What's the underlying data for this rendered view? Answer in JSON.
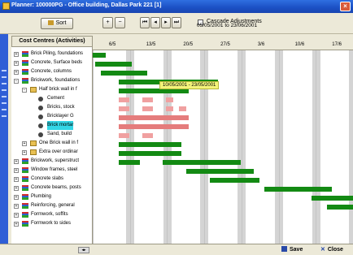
{
  "window": {
    "title": "Planner: 100000PG - Office building, Dallas Park 221 [1]",
    "close_glyph": "×"
  },
  "toolbar": {
    "sort_label": "Sort",
    "zoom_in_glyph": "+",
    "zoom_out_glyph": "−",
    "nav_first_glyph": "⏮",
    "nav_prev_glyph": "◂",
    "nav_next_glyph": "▸",
    "nav_last_glyph": "⏭",
    "cascade_label": "Cascade Adjustments",
    "cascade_checked": false,
    "date_range": "05/05/2001 to 23/06/2001"
  },
  "tree": {
    "header": "Cost Centres (Activities)",
    "rows": [
      {
        "label": "Brick Piling, foundations",
        "level": 0,
        "icon": "bars-icon",
        "expander": "+"
      },
      {
        "label": "Concrete, Surface beds",
        "level": 0,
        "icon": "bars-icon",
        "expander": "+"
      },
      {
        "label": "Concrete, columns",
        "level": 0,
        "icon": "bars-icon",
        "expander": "+"
      },
      {
        "label": "Brickwork, foundations",
        "level": 0,
        "icon": "bars-icon",
        "expander": "−"
      },
      {
        "label": "Half brick wall in f",
        "level": 1,
        "icon": "folder-icon",
        "expander": "−"
      },
      {
        "label": "Cement",
        "level": 2,
        "icon": "item-icon",
        "expander": ""
      },
      {
        "label": "Bricks, stock",
        "level": 2,
        "icon": "item-icon",
        "expander": ""
      },
      {
        "label": "Bricklayer G",
        "level": 2,
        "icon": "item-icon",
        "expander": ""
      },
      {
        "label": "Brick mortar",
        "level": 2,
        "icon": "item-icon",
        "expander": "",
        "highlight": true
      },
      {
        "label": "Sand, build",
        "level": 2,
        "icon": "item-icon",
        "expander": ""
      },
      {
        "label": "One Brick wall in f",
        "level": 1,
        "icon": "folder-icon",
        "expander": "+"
      },
      {
        "label": "Extra over ordinar",
        "level": 1,
        "icon": "folder-icon",
        "expander": "+"
      },
      {
        "label": "Brickwork, superstruct",
        "level": 0,
        "icon": "bars-icon",
        "expander": "+"
      },
      {
        "label": "Window frames, steel",
        "level": 0,
        "icon": "bars-icon",
        "expander": "+"
      },
      {
        "label": "Concrete slabs",
        "level": 0,
        "icon": "bars-icon",
        "expander": "+"
      },
      {
        "label": "Concrete beams, posts",
        "level": 0,
        "icon": "bars-icon",
        "expander": "+"
      },
      {
        "label": "Plumbing",
        "level": 0,
        "icon": "bars-icon",
        "expander": "+"
      },
      {
        "label": "Reinforcing, general",
        "level": 0,
        "icon": "bars-icon",
        "expander": "+"
      },
      {
        "label": "Formwork, soffits",
        "level": 0,
        "icon": "bars-icon",
        "expander": "+"
      },
      {
        "label": "Formwork to sides",
        "level": 0,
        "icon": "bars-icon",
        "expander": "+"
      }
    ]
  },
  "timeline": {
    "dates": [
      "6/5",
      "13/5",
      "20/5",
      "27/5",
      "3/6",
      "10/6",
      "17/6"
    ]
  },
  "gantt": {
    "tooltip": "10/05/2001 - 23/05/2001",
    "bars": [
      {
        "row": 0,
        "start": 0,
        "end": 0.05,
        "color": "green"
      },
      {
        "row": 1,
        "start": 0.01,
        "end": 0.15,
        "color": "green"
      },
      {
        "row": 2,
        "start": 0.03,
        "end": 0.21,
        "color": "green"
      },
      {
        "row": 3,
        "start": 0.1,
        "end": 0.48,
        "color": "green"
      },
      {
        "row": 4,
        "start": 0.1,
        "end": 0.37,
        "color": "green"
      },
      {
        "row": 5,
        "start": 0.1,
        "end": 0.14,
        "color": "pink"
      },
      {
        "row": 5,
        "start": 0.19,
        "end": 0.23,
        "color": "pink"
      },
      {
        "row": 5,
        "start": 0.28,
        "end": 0.31,
        "color": "pink"
      },
      {
        "row": 6,
        "start": 0.1,
        "end": 0.14,
        "color": "pink"
      },
      {
        "row": 6,
        "start": 0.19,
        "end": 0.23,
        "color": "pink"
      },
      {
        "row": 6,
        "start": 0.28,
        "end": 0.31,
        "color": "pink"
      },
      {
        "row": 6,
        "start": 0.33,
        "end": 0.36,
        "color": "pink"
      },
      {
        "row": 7,
        "start": 0.1,
        "end": 0.37,
        "color": "pinkdark"
      },
      {
        "row": 8,
        "start": 0.1,
        "end": 0.37,
        "color": "pinkdark"
      },
      {
        "row": 9,
        "start": 0.1,
        "end": 0.14,
        "color": "pink"
      },
      {
        "row": 9,
        "start": 0.19,
        "end": 0.23,
        "color": "pink"
      },
      {
        "row": 10,
        "start": 0.1,
        "end": 0.34,
        "color": "green"
      },
      {
        "row": 11,
        "start": 0.1,
        "end": 0.34,
        "color": "green"
      },
      {
        "row": 12,
        "start": 0.1,
        "end": 0.18,
        "color": "green"
      },
      {
        "row": 12,
        "start": 0.27,
        "end": 0.57,
        "color": "green"
      },
      {
        "row": 13,
        "start": 0.36,
        "end": 0.62,
        "color": "green"
      },
      {
        "row": 14,
        "start": 0.45,
        "end": 0.64,
        "color": "green"
      },
      {
        "row": 15,
        "start": 0.66,
        "end": 0.92,
        "color": "green"
      },
      {
        "row": 16,
        "start": 0.84,
        "end": 1.0,
        "color": "green"
      },
      {
        "row": 17,
        "start": 0.9,
        "end": 1.0,
        "color": "green"
      }
    ]
  },
  "footer": {
    "save_label": "Save",
    "close_label": "Close",
    "close_glyph": "✕",
    "scroll_glyph": "◂▸"
  }
}
